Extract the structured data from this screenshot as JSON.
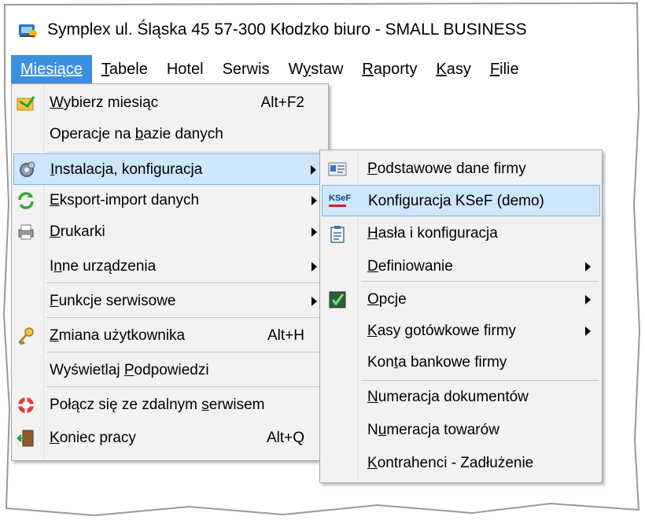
{
  "window": {
    "title": "Symplex ul. Śląska 45 57-300 Kłodzko biuro - SMALL BUSINESS"
  },
  "menubar": [
    {
      "pre": "",
      "u": "Miesiące",
      "post": "",
      "active": true
    },
    {
      "pre": "",
      "u": "T",
      "post": "abele",
      "active": false
    },
    {
      "pre": "",
      "u": "",
      "post": "Hotel",
      "active": false
    },
    {
      "pre": "",
      "u": "",
      "post": "Serwis",
      "active": false
    },
    {
      "pre": "W",
      "u": "y",
      "post": "staw",
      "active": false
    },
    {
      "pre": "",
      "u": "R",
      "post": "aporty",
      "active": false
    },
    {
      "pre": "",
      "u": "K",
      "post": "asy",
      "active": false
    },
    {
      "pre": "",
      "u": "F",
      "post": "ilie",
      "active": false
    }
  ],
  "main_menu": {
    "items": [
      {
        "name": "wybierz-miesiac",
        "pre": "",
        "u": "W",
        "post": "ybierz miesiąc",
        "shortcut": "Alt+F2",
        "icon": "folder-arrow-icon"
      },
      {
        "name": "operacje-na-bazie",
        "pre": "Operacje na ",
        "u": "b",
        "post": "azie danych",
        "shortcut": "",
        "icon": ""
      },
      {
        "name": "instalacja-konfiguracja",
        "pre": "",
        "u": "I",
        "post": "nstalacja, konfiguracja",
        "shortcut": "",
        "icon": "gear-icon",
        "submenu": true,
        "highlight": true
      },
      {
        "name": "eksport-import",
        "pre": "",
        "u": "E",
        "post": "ksport-import danych",
        "shortcut": "",
        "icon": "refresh-arrows-icon",
        "submenu": true
      },
      {
        "name": "drukarki",
        "pre": "",
        "u": "D",
        "post": "rukarki",
        "shortcut": "",
        "icon": "printer-icon",
        "submenu": true
      },
      {
        "name": "inne-urzadzenia",
        "pre": "I",
        "u": "n",
        "post": "ne urządzenia",
        "shortcut": "",
        "icon": "",
        "submenu": true
      },
      {
        "name": "funkcje-serwisowe",
        "pre": "",
        "u": "F",
        "post": "unkcje serwisowe",
        "shortcut": "",
        "icon": "",
        "submenu": true
      },
      {
        "name": "zmiana-uzytkownika",
        "pre": "",
        "u": "Z",
        "post": "miana użytkownika",
        "shortcut": "Alt+H",
        "icon": "key-icon"
      },
      {
        "name": "wyswietlaj-podpowiedzi",
        "pre": "Wyświetlaj ",
        "u": "P",
        "post": "odpowiedzi",
        "shortcut": "",
        "icon": ""
      },
      {
        "name": "polacz-zdalny-serwis",
        "pre": "Połącz się ze zdalnym ",
        "u": "s",
        "post": "erwisem",
        "shortcut": "",
        "icon": "lifebuoy-icon"
      },
      {
        "name": "koniec-pracy",
        "pre": "",
        "u": "K",
        "post": "oniec pracy",
        "shortcut": "Alt+Q",
        "icon": "exit-door-icon"
      }
    ]
  },
  "sub_menu": {
    "items": [
      {
        "name": "podstawowe-dane-firmy",
        "pre": "",
        "u": "P",
        "post": "odstawowe dane firmy",
        "icon": "id-card-icon"
      },
      {
        "name": "konfiguracja-ksef",
        "pre": "Konfiguracja KSeF (demo)",
        "u": "",
        "post": "",
        "icon": "ksef-logo-icon",
        "highlight": true,
        "icon_text": "KSeF"
      },
      {
        "name": "hasla-konfiguracja",
        "pre": "",
        "u": "H",
        "post": "asła i konfiguracja",
        "icon": "clipboard-icon"
      },
      {
        "name": "definiowanie",
        "pre": "",
        "u": "D",
        "post": "efiniowanie",
        "icon": "",
        "submenu": true
      },
      {
        "name": "opcje",
        "pre": "",
        "u": "O",
        "post": "pcje",
        "icon": "checkbox-icon",
        "submenu": true
      },
      {
        "name": "kasy-gotowkowe",
        "pre": "",
        "u": "K",
        "post": "asy gotówkowe firmy",
        "icon": "",
        "submenu": true
      },
      {
        "name": "konta-bankowe",
        "pre": "Kon",
        "u": "t",
        "post": "a bankowe firmy",
        "icon": ""
      },
      {
        "name": "numeracja-dokumentow",
        "pre": "",
        "u": "N",
        "post": "umeracja dokumentów",
        "icon": ""
      },
      {
        "name": "numeracja-towarow",
        "pre": "N",
        "u": "u",
        "post": "meracja towarów",
        "icon": ""
      },
      {
        "name": "kontrahenci-zadluzenie",
        "pre": "",
        "u": "K",
        "post": "ontrahenci - Zadłużenie",
        "icon": ""
      }
    ]
  },
  "colors": {
    "accent": "#3c8fe0",
    "highlight_bg": "#cde6fb",
    "highlight_border": "#7ab6ea",
    "menu_bg": "#f2f2f2"
  }
}
